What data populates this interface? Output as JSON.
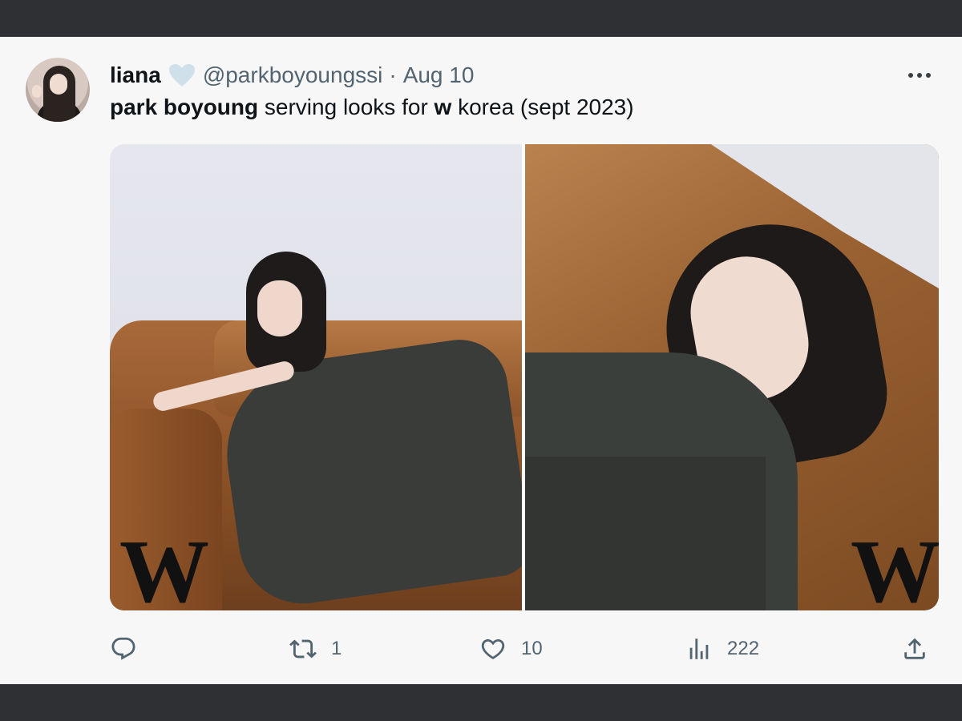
{
  "tweet": {
    "author_name": "liana",
    "handle": "@parkboyoungssi",
    "separator": "·",
    "date": "Aug 10",
    "text_parts": [
      {
        "text": "park boyoung",
        "bold": true
      },
      {
        "text": " serving looks for ",
        "bold": false
      },
      {
        "text": "w",
        "bold": true
      },
      {
        "text": " korea (sept 2023)",
        "bold": false
      }
    ],
    "media": [
      {
        "logo": "W",
        "alt": "photo-left"
      },
      {
        "logo": "W",
        "alt": "photo-right"
      }
    ],
    "actions": {
      "reply": {
        "icon": "reply-icon",
        "count": ""
      },
      "retweet": {
        "icon": "retweet-icon",
        "count": "1"
      },
      "like": {
        "icon": "heart-icon",
        "count": "10"
      },
      "views": {
        "icon": "views-icon",
        "count": "222"
      },
      "share": {
        "icon": "share-icon",
        "count": ""
      }
    }
  },
  "colors": {
    "frame": "#2f3033",
    "card_background": "#f7f7f7",
    "text_primary": "#0f1419",
    "text_secondary": "#536471",
    "heart_badge": "#cfe0ea"
  }
}
